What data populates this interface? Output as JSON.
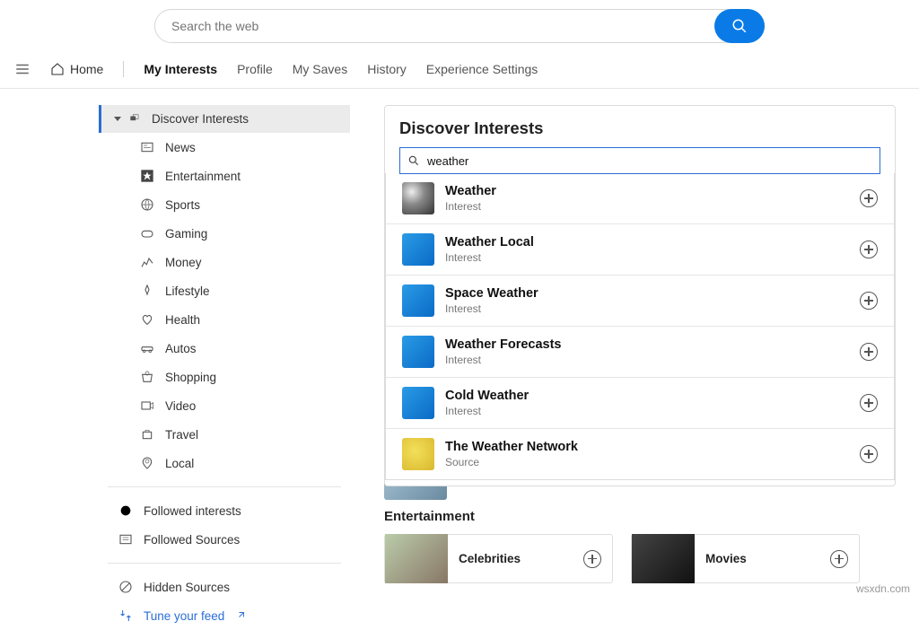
{
  "top_search": {
    "placeholder": "Search the web"
  },
  "nav": {
    "home": "Home",
    "tabs": [
      {
        "label": "My Interests",
        "active": true
      },
      {
        "label": "Profile"
      },
      {
        "label": "My Saves"
      },
      {
        "label": "History"
      },
      {
        "label": "Experience Settings"
      }
    ]
  },
  "sidebar": {
    "discover": "Discover Interests",
    "items": [
      {
        "icon": "news",
        "label": "News"
      },
      {
        "icon": "star",
        "label": "Entertainment"
      },
      {
        "icon": "sports",
        "label": "Sports"
      },
      {
        "icon": "gaming",
        "label": "Gaming"
      },
      {
        "icon": "money",
        "label": "Money"
      },
      {
        "icon": "lifestyle",
        "label": "Lifestyle"
      },
      {
        "icon": "health",
        "label": "Health"
      },
      {
        "icon": "autos",
        "label": "Autos"
      },
      {
        "icon": "shopping",
        "label": "Shopping"
      },
      {
        "icon": "video",
        "label": "Video"
      },
      {
        "icon": "travel",
        "label": "Travel"
      },
      {
        "icon": "local",
        "label": "Local"
      }
    ],
    "followed_interests": "Followed interests",
    "followed_sources": "Followed Sources",
    "hidden_sources": "Hidden Sources",
    "tune_feed": "Tune your feed"
  },
  "panel": {
    "title": "Discover Interests",
    "search_value": "weather",
    "results": [
      {
        "title": "Weather",
        "sub": "Interest",
        "thumb": "tornado"
      },
      {
        "title": "Weather Local",
        "sub": "Interest",
        "thumb": "blue"
      },
      {
        "title": "Space Weather",
        "sub": "Interest",
        "thumb": "blue"
      },
      {
        "title": "Weather Forecasts",
        "sub": "Interest",
        "thumb": "blue"
      },
      {
        "title": "Cold Weather",
        "sub": "Interest",
        "thumb": "blue"
      },
      {
        "title": "The Weather Network",
        "sub": "Source",
        "thumb": "yellow"
      }
    ]
  },
  "sections": {
    "entertainment": "Entertainment",
    "cards": [
      {
        "label": "Celebrities"
      },
      {
        "label": "Movies"
      }
    ]
  },
  "watermark": "wsxdn.com"
}
